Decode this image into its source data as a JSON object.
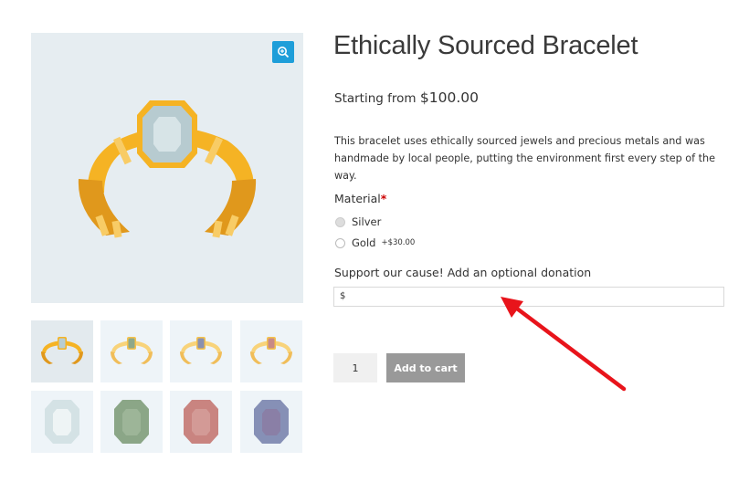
{
  "product": {
    "title": "Ethically Sourced Bracelet",
    "price_prefix": "Starting from",
    "price": "$100.00",
    "description": "This bracelet uses ethically sourced jewels and precious metals and was handmade by local people, putting the environment first every step of the way."
  },
  "material": {
    "label": "Material",
    "required_mark": "*",
    "options": [
      {
        "label": "Silver",
        "extra": "",
        "selected": true
      },
      {
        "label": "Gold",
        "extra": "+$30.00",
        "selected": false
      }
    ]
  },
  "donation": {
    "label": "Support our cause! Add an optional donation",
    "currency_symbol": "$"
  },
  "cart": {
    "quantity": "1",
    "add_label": "Add to cart"
  },
  "gallery": {
    "zoom_icon": "zoom-in-icon",
    "thumbnails": [
      {
        "name": "bracelet-silver",
        "gem": "#b8cdd2"
      },
      {
        "name": "bracelet-green",
        "gem": "#8ea88a"
      },
      {
        "name": "bracelet-blue",
        "gem": "#8a90b0"
      },
      {
        "name": "bracelet-red",
        "gem": "#c88a86"
      },
      {
        "name": "gem-silver",
        "gem": "#d4e2e5"
      },
      {
        "name": "gem-green",
        "gem": "#8ba687"
      },
      {
        "name": "gem-red",
        "gem": "#c98480"
      },
      {
        "name": "gem-blue",
        "gem": "#8690b6"
      }
    ]
  },
  "colors": {
    "accent": "#1e9ed9",
    "gold": "#f5b324",
    "button": "#999999",
    "annotation_arrow": "#e8141b"
  }
}
